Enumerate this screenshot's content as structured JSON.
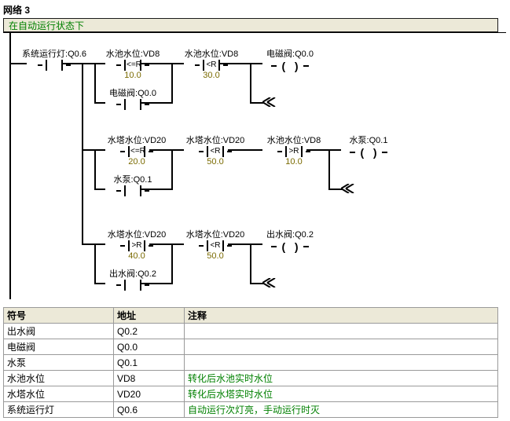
{
  "network": {
    "title": "网络 3",
    "comment": "在自动运行状态下"
  },
  "rung1": {
    "c1": {
      "label": "系统运行灯:Q0.6",
      "inner": ""
    },
    "c2": {
      "label": "水池水位:VD8",
      "inner": "<=R",
      "val": "10.0"
    },
    "c3": {
      "label": "水池水位:VD8",
      "inner": "<R",
      "val": "30.0"
    },
    "coil": {
      "label": "电磁阀:Q0.0"
    },
    "p1": {
      "label": "电磁阀:Q0.0",
      "inner": ""
    }
  },
  "rung2": {
    "c1": {
      "label": "水塔水位:VD20",
      "inner": "<=R",
      "val": "20.0"
    },
    "c2": {
      "label": "水塔水位:VD20",
      "inner": "<R",
      "val": "50.0"
    },
    "c3": {
      "label": "水池水位:VD8",
      "inner": ">R",
      "val": "10.0"
    },
    "coil": {
      "label": "水泵:Q0.1"
    },
    "p1": {
      "label": "水泵:Q0.1",
      "inner": ""
    }
  },
  "rung3": {
    "c1": {
      "label": "水塔水位:VD20",
      "inner": ">R",
      "val": "40.0"
    },
    "c2": {
      "label": "水塔水位:VD20",
      "inner": "<R",
      "val": "50.0"
    },
    "coil": {
      "label": "出水阀:Q0.2"
    },
    "p1": {
      "label": "出水阀:Q0.2",
      "inner": ""
    }
  },
  "table": {
    "headers": [
      "符号",
      "地址",
      "注释"
    ],
    "rows": [
      {
        "sym": "出水阀",
        "addr": "Q0.2",
        "cmt": ""
      },
      {
        "sym": "电磁阀",
        "addr": "Q0.0",
        "cmt": ""
      },
      {
        "sym": "水泵",
        "addr": "Q0.1",
        "cmt": ""
      },
      {
        "sym": "水池水位",
        "addr": "VD8",
        "cmt": "转化后水池实时水位"
      },
      {
        "sym": "水塔水位",
        "addr": "VD20",
        "cmt": "转化后水塔实时水位"
      },
      {
        "sym": "系统运行灯",
        "addr": "Q0.6",
        "cmt": "自动运行次灯亮，手动运行时灭"
      }
    ]
  }
}
